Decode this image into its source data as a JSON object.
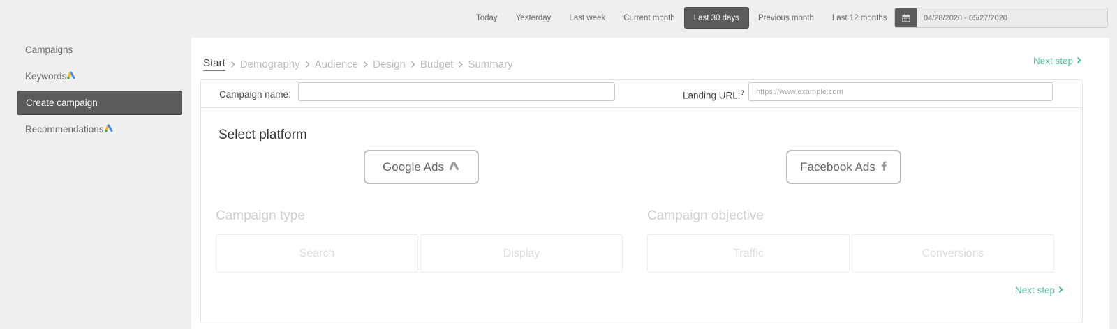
{
  "date_range": {
    "options": [
      "Today",
      "Yesterday",
      "Last week",
      "Current month",
      "Last 30 days",
      "Previous month",
      "Last 12 months"
    ],
    "selected": "Last 30 days",
    "value": "04/28/2020 - 05/27/2020",
    "icon": "calendar-icon"
  },
  "sidebar": {
    "items": [
      {
        "label": "Campaigns",
        "badge": false,
        "active": false
      },
      {
        "label": "Keywords",
        "badge": true,
        "active": false
      },
      {
        "label": "Create campaign",
        "badge": false,
        "active": true
      },
      {
        "label": "Recommendations",
        "badge": true,
        "active": false
      }
    ]
  },
  "wizard": {
    "steps": [
      "Start",
      "Demography",
      "Audience",
      "Design",
      "Budget",
      "Summary"
    ],
    "current": "Start",
    "next_label": "Next step"
  },
  "form": {
    "campaign_name_label": "Campaign name:",
    "campaign_name_value": "",
    "landing_url_label": "Landing URL:",
    "landing_url_help": "?",
    "landing_url_placeholder": "https://www.example.com"
  },
  "platform": {
    "title": "Select platform",
    "google_label": "Google Ads",
    "facebook_label": "Facebook Ads"
  },
  "campaign_type": {
    "title": "Campaign type",
    "options": [
      "Search",
      "Display"
    ]
  },
  "campaign_objective": {
    "title": "Campaign objective",
    "options": [
      "Traffic",
      "Conversions"
    ]
  },
  "colors": {
    "accent": "#4fbf9a",
    "active_bg": "#5b5b5b",
    "google_blue": "#4285f4",
    "google_yellow": "#fbbc04",
    "google_green": "#34a853"
  }
}
